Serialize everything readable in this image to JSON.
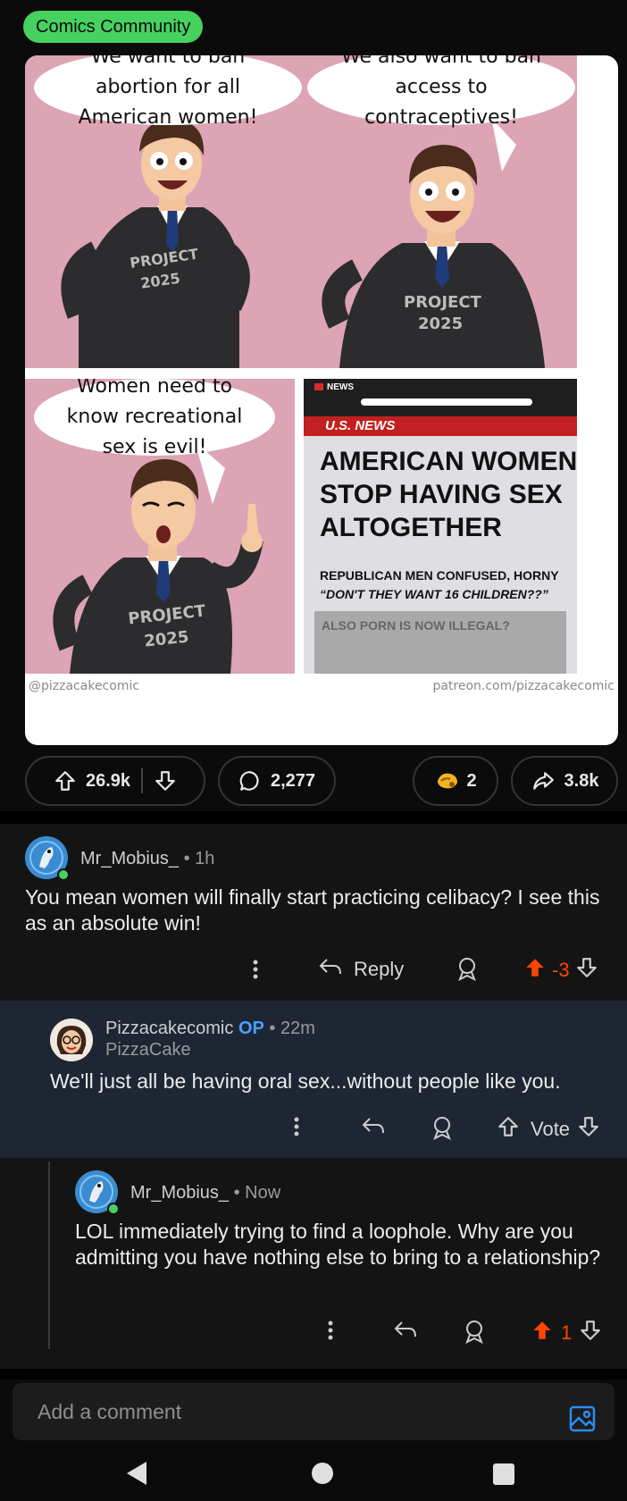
{
  "post": {
    "flair": "Comics Community",
    "comic": {
      "panel1_text": "We want to ban abortion for all American women!",
      "panel2_text": "We also want to ban access to contraceptives!",
      "panel3_text": "Women need to know recreational sex is evil!",
      "suit_text_line1": "PROJECT",
      "suit_text_line2": "2025",
      "news_tag": "NEWS",
      "news_section": "U.S. NEWS",
      "news_headline": "AMERICAN WOMEN STOP HAVING SEX ALTOGETHER",
      "news_subhead": "REPUBLICAN MEN CONFUSED, HORNY",
      "news_quote": "“DON'T THEY WANT 16 CHILDREN??”",
      "news_box": "ALSO PORN IS NOW ILLEGAL?",
      "credit_left": "@pizzacakecomic",
      "credit_right": "patreon.com/pizzacakecomic"
    },
    "actions": {
      "upvotes": "26.9k",
      "comments": "2,277",
      "awards": "2",
      "shares": "3.8k"
    }
  },
  "comments": [
    {
      "username": "Mr_Mobius_",
      "time": "• 1h",
      "text": "You mean women will finally start practicing celibacy? I see this as an absolute win!",
      "reply_label": "Reply",
      "score": "-3"
    },
    {
      "username": "Pizzacakecomic",
      "op_badge": "OP",
      "time": "• 22m",
      "flair": "PizzaCake",
      "text": "We'll just all be having oral sex...without people like you.",
      "vote_label": "Vote"
    },
    {
      "username": "Mr_Mobius_",
      "time": "• Now",
      "text": "LOL immediately trying to find a loophole. Why are you admitting you have nothing else to bring to a relationship?",
      "score": "1"
    }
  ],
  "composer": {
    "placeholder": "Add a comment"
  },
  "colors": {
    "upvote_active": "#ff4500",
    "op_blue": "#4a9eff",
    "flair_green": "#46d160",
    "background": "#0b0b0b"
  },
  "icons": [
    "upvote-icon",
    "downvote-icon",
    "comment-bubble-icon",
    "award-icon",
    "share-icon",
    "more-vert-icon",
    "reply-icon",
    "image-icon",
    "nav-back-icon",
    "nav-home-icon",
    "nav-recents-icon"
  ]
}
